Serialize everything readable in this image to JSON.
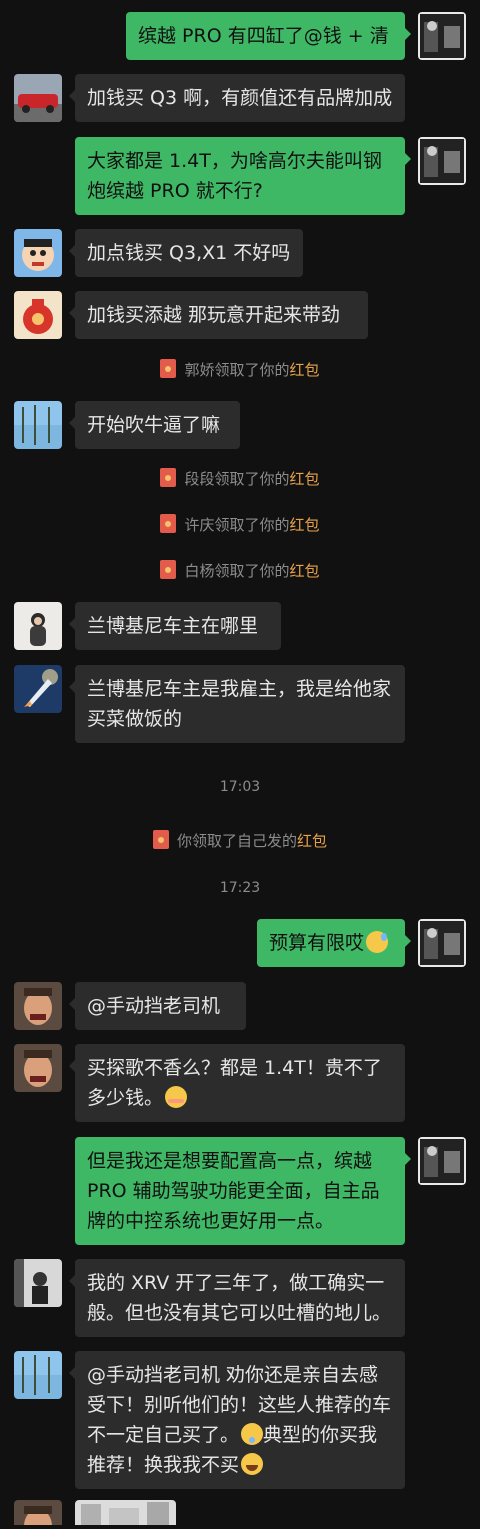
{
  "messages": [
    {
      "id": "m1",
      "side": "out",
      "text": "缤越 PRO 有四缸了@钱 + 清"
    },
    {
      "id": "m2",
      "side": "in",
      "text": "加钱买 Q3 啊，有颜值还有品牌加成"
    },
    {
      "id": "m3",
      "side": "out",
      "text": "大家都是 1.4T，为啥高尔夫能叫钢炮缤越 PRO 就不行?"
    },
    {
      "id": "m4",
      "side": "in",
      "text": "加点钱买 Q3,X1 不好吗"
    },
    {
      "id": "m5",
      "side": "in",
      "text": "加钱买添越 那玩意开起来带劲"
    },
    {
      "id": "m6",
      "side": "in",
      "text": "开始吹牛逼了嘛"
    },
    {
      "id": "m7",
      "side": "in",
      "text": "兰博基尼车主在哪里"
    },
    {
      "id": "m8",
      "side": "in",
      "text": "兰博基尼车主是我雇主，我是给他家买菜做饭的"
    },
    {
      "id": "m9",
      "side": "out",
      "text": "预算有限哎"
    },
    {
      "id": "m10",
      "side": "in",
      "text": "@手动挡老司机"
    },
    {
      "id": "m11",
      "side": "in",
      "text": "买探歌不香么？都是 1.4T！贵不了多少钱。"
    },
    {
      "id": "m12",
      "side": "out",
      "text": "但是我还是想要配置高一点，缤越 PRO 辅助驾驶功能更全面，自主品牌的中控系统也更好用一点。"
    },
    {
      "id": "m13",
      "side": "in",
      "text": "我的 XRV 开了三年了，做工确实一般。但也没有其它可以吐槽的地儿。"
    },
    {
      "id": "m14",
      "side": "in",
      "text": "@手动挡老司机 劝你还是亲自去感受下！别听他们的！这些人推荐的车不一定自己买了。",
      "text2": "典型的你买我推荐！换我我不买"
    }
  ],
  "system": {
    "s1_text": "郭娇领取了你的",
    "s2_text": "段段领取了你的",
    "s3_text": "许庆领取了你的",
    "s4_text": "白杨领取了你的",
    "s5_text": "你领取了自己发的",
    "red_packet": "红包"
  },
  "times": {
    "t1": "17:03",
    "t2": "17:23"
  },
  "icons": {
    "self_avatar": "avatar-self",
    "car_avatar": "red-car-avatar",
    "shinchan_avatar": "cartoon-boy-avatar",
    "redbag_avatar": "red-lucky-bag-avatar",
    "lake_avatar": "lake-trees-avatar",
    "girl_avatar": "girl-portrait-avatar",
    "rocket_avatar": "rocket-launch-avatar",
    "man_avatar": "laughing-man-avatar",
    "bw_avatar": "bw-street-avatar"
  },
  "colors": {
    "bg": "#111111",
    "incoming": "#2c2c2c",
    "outgoing": "#3fb866",
    "link": "#e8a34a"
  }
}
